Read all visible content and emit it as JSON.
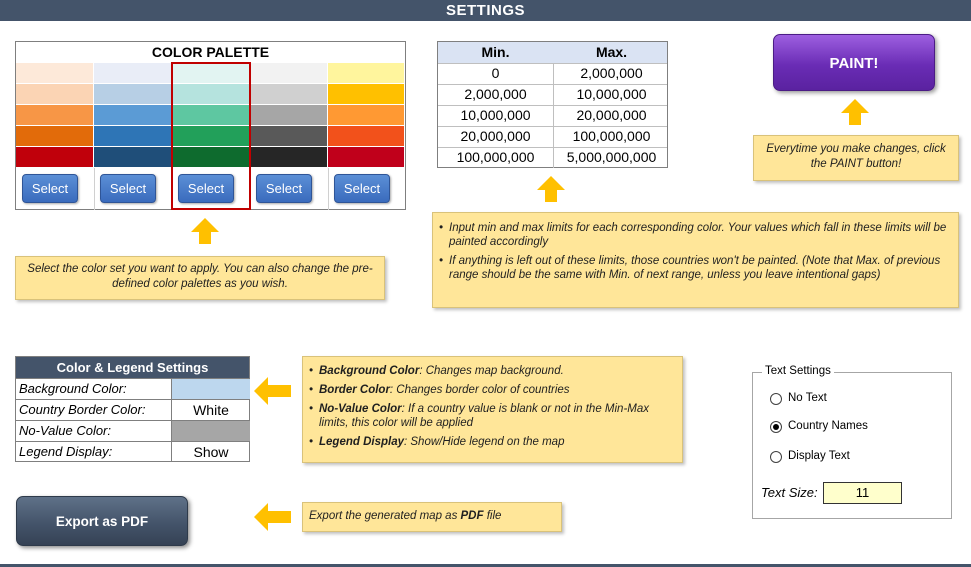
{
  "header": {
    "title": "SETTINGS"
  },
  "palette": {
    "title": "COLOR PALETTE",
    "columns": [
      {
        "colors": [
          "#fde9d9",
          "#fbd4b4",
          "#f79646",
          "#e26b0a",
          "#c0000b"
        ],
        "select_label": "Select"
      },
      {
        "colors": [
          "#e9edf7",
          "#b7cfe5",
          "#5b9bd5",
          "#2e75b6",
          "#1f4e79"
        ],
        "select_label": "Select"
      },
      {
        "colors": [
          "#e2f4f2",
          "#b5e3de",
          "#5ec7a1",
          "#22a05a",
          "#0e6b2e"
        ],
        "select_label": "Select"
      },
      {
        "colors": [
          "#f2f2f2",
          "#d0d0d0",
          "#a6a6a6",
          "#595959",
          "#262626"
        ],
        "select_label": "Select"
      },
      {
        "colors": [
          "#fff59d",
          "#ffc000",
          "#ff9933",
          "#f2511b",
          "#c0001b"
        ],
        "select_label": "Select"
      }
    ],
    "selected_index": 2
  },
  "range": {
    "headers": [
      "Min.",
      "Max."
    ],
    "rows": [
      [
        "0",
        "2,000,000"
      ],
      [
        "2,000,000",
        "10,000,000"
      ],
      [
        "10,000,000",
        "20,000,000"
      ],
      [
        "20,000,000",
        "100,000,000"
      ],
      [
        "100,000,000",
        "5,000,000,000"
      ]
    ]
  },
  "paint_button": {
    "label": "PAINT!"
  },
  "notes": {
    "paint": "Everytime you make changes, click the PAINT button!",
    "palette": "Select the color set you want to apply. You can also change the pre-defined color palettes as you wish.",
    "range": [
      "Input min and max limits for each corresponding color. Your values which fall in these limits will be painted accordingly",
      "If anything is left out of these limits, those countries won't be painted. (Note that Max. of previous range should be the same with Min. of next range, unless you leave intentional gaps)"
    ],
    "legend": [
      {
        "term": "Background Color",
        "text": ": Changes map background."
      },
      {
        "term": "Border Color",
        "text": ": Changes border color of countries"
      },
      {
        "term": "No-Value Color",
        "text": ": If a country value is blank or not in the Min-Max limits, this color will be applied"
      },
      {
        "term": "Legend Display",
        "text": ":  Show/Hide legend on the map"
      }
    ],
    "export_pre": "Export the generated map as ",
    "export_term": "PDF",
    "export_post": " file"
  },
  "legend_settings": {
    "title": "Color & Legend Settings",
    "rows": [
      {
        "label": "Background Color:",
        "value": "",
        "swatch": "#bdd7ee"
      },
      {
        "label": "Country Border Color:",
        "value": "White",
        "swatch": ""
      },
      {
        "label": "No-Value Color:",
        "value": "",
        "swatch": "#a6a6a6"
      },
      {
        "label": "Legend Display:",
        "value": "Show",
        "swatch": ""
      }
    ]
  },
  "text_settings": {
    "title": "Text Settings",
    "options": [
      {
        "label": "No Text",
        "selected": false
      },
      {
        "label": "Country Names",
        "selected": true
      },
      {
        "label": "Display Text",
        "selected": false
      }
    ],
    "size_label": "Text Size:",
    "size_value": "11"
  },
  "export_button": {
    "label": "Export as PDF"
  },
  "colors": {
    "header": "#44546a",
    "note": "#ffe699",
    "arrow": "#ffc000",
    "paint": "#7030a0"
  }
}
